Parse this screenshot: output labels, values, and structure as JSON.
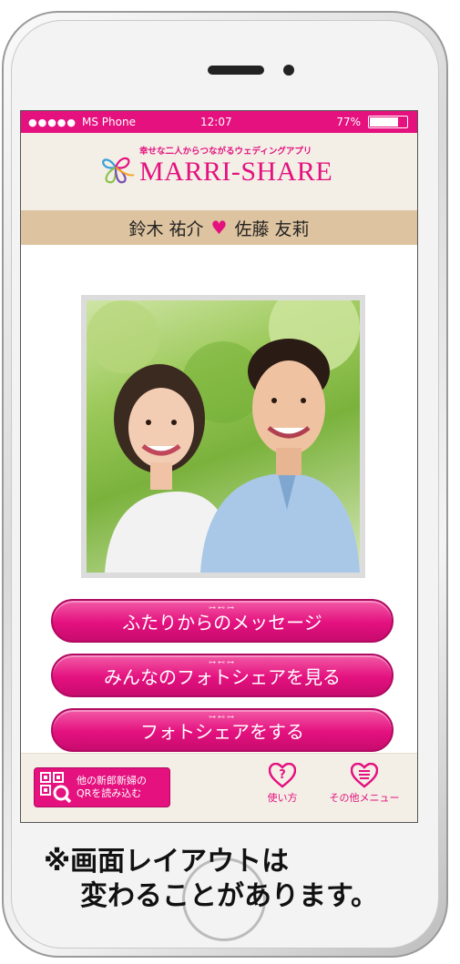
{
  "status_bar": {
    "signal_dots": "●●●●●",
    "carrier": "MS Phone",
    "time": "12:07",
    "battery_percent": "77%",
    "battery_level": 0.77
  },
  "header": {
    "tagline": "幸せな二人からつながるウェディングアプリ",
    "brand": "MARRI-SHARE"
  },
  "couple": {
    "groom": "鈴木 祐介",
    "bride": "佐藤 友莉",
    "heart": "♥"
  },
  "buttons": {
    "message": "ふたりからのメッセージ",
    "view_photo_share": "みんなのフォトシェアを見る",
    "do_photo_share": "フォトシェアをする"
  },
  "bottom_nav": {
    "qr_label_line1": "他の新郎新婦の",
    "qr_label_line2": "QRを読み込む",
    "help_label": "使い方",
    "menu_label": "その他メニュー"
  },
  "disclaimer": {
    "line1": "※画面レイアウトは",
    "line2": "変わることがあります。"
  },
  "colors": {
    "accent": "#e4117f",
    "header_bg": "#f3efe6",
    "names_bar_bg": "#ddc39f"
  }
}
